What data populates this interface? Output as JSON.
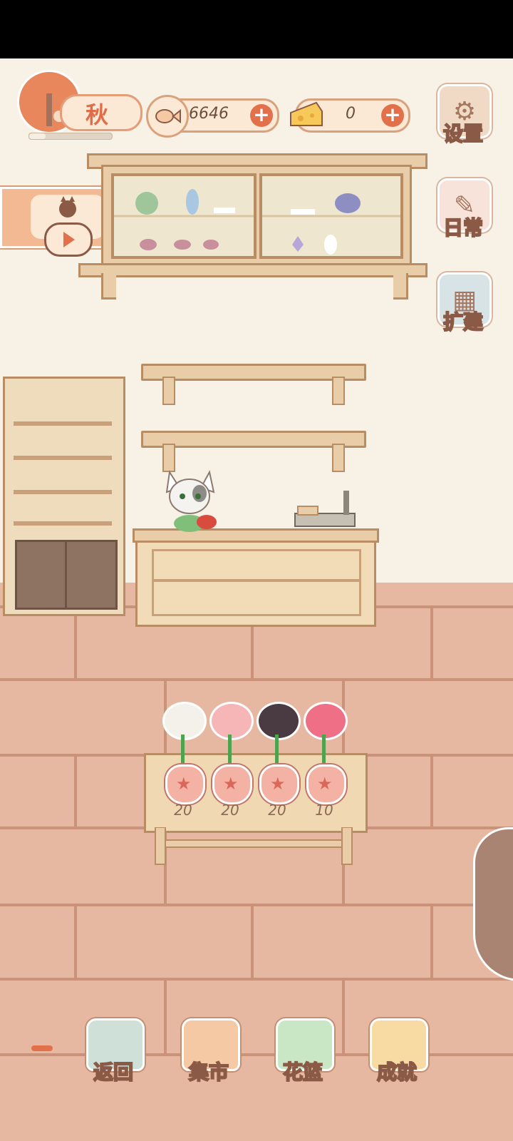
{
  "season": {
    "label": "秋",
    "progress": 0.2
  },
  "currencies": {
    "fish": {
      "value": "6646",
      "icon": "fish-bone-icon",
      "plus": "+"
    },
    "cheese": {
      "value": "0",
      "icon": "cheese-icon",
      "plus": "+"
    }
  },
  "side_menu": {
    "settings": {
      "label": "设置",
      "icon": "gear-icon"
    },
    "daily": {
      "label": "日常",
      "icon": "tips-note-icon"
    },
    "expand": {
      "label": "扩建",
      "icon": "paint-bucket-icon"
    }
  },
  "video_ad": {
    "icon": "cat-play-icon"
  },
  "flowers": [
    {
      "name": "white-rose",
      "color": "#f4f1ea",
      "price": "20"
    },
    {
      "name": "pink-lotus",
      "color": "#f6b6b8",
      "price": "20"
    },
    {
      "name": "black-rose",
      "color": "#4a3a42",
      "price": "20"
    },
    {
      "name": "red-rose",
      "color": "#ee6f86",
      "price": "10"
    }
  ],
  "bottom_nav": [
    {
      "label": "返回",
      "icon": "window-landscape-icon",
      "color": "#cfe0d8"
    },
    {
      "label": "集市",
      "icon": "market-stall-icon",
      "color": "#f4c9a4"
    },
    {
      "label": "花篮",
      "icon": "flower-basket-icon",
      "color": "#c9e7c5"
    },
    {
      "label": "成就",
      "icon": "trophy-icon",
      "color": "#f7dba2"
    }
  ],
  "colors": {
    "accent": "#e2704b",
    "wall": "#f8f1e6",
    "floor": "#e7b8a1",
    "wood": "#e8cda8"
  }
}
